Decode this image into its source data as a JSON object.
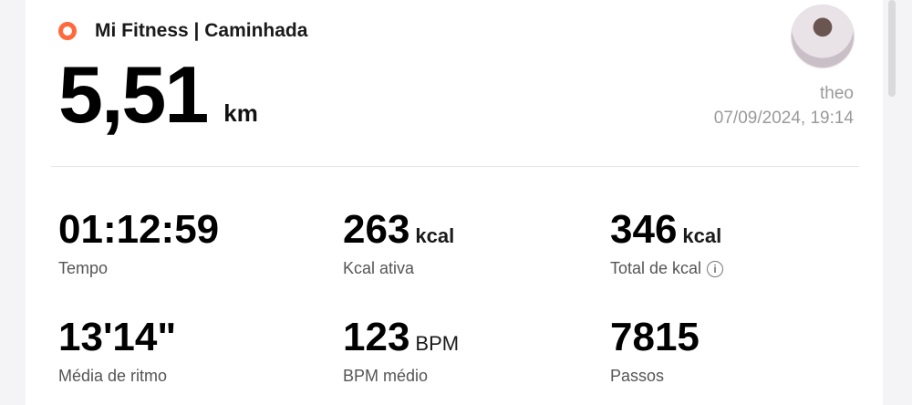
{
  "header": {
    "app_icon": "ring-icon",
    "app_title": "Mi Fitness | Caminhada",
    "distance_value": "5,51",
    "distance_unit": "km",
    "user_name": "theo",
    "timestamp": "07/09/2024, 19:14",
    "accent_color": "#ff6a3d"
  },
  "metrics": [
    {
      "value": "01:12:59",
      "unit": "",
      "label": "Tempo"
    },
    {
      "value": "263",
      "unit": "kcal",
      "label": "Kcal ativa"
    },
    {
      "value": "346",
      "unit": "kcal",
      "label": "Total de kcal",
      "info_icon": "info-icon"
    },
    {
      "value": "13'14\"",
      "unit": "",
      "label": "Média de ritmo"
    },
    {
      "value": "123",
      "unit": "BPM",
      "label": "BPM médio"
    },
    {
      "value": "7815",
      "unit": "",
      "label": "Passos"
    }
  ]
}
